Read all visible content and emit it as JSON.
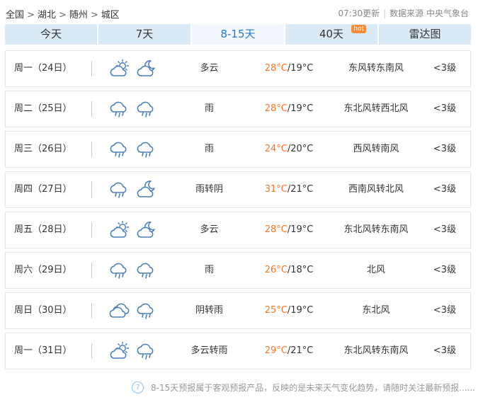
{
  "breadcrumb": {
    "items": [
      "全国",
      "湖北",
      "随州",
      "城区"
    ],
    "separator": ">"
  },
  "meta": {
    "update_time": "07:30更新",
    "source_label": "数据来源",
    "source": "中央气象台"
  },
  "tabs": [
    {
      "label": "今天",
      "active": false
    },
    {
      "label": "7天",
      "active": false
    },
    {
      "label": "8-15天",
      "active": true
    },
    {
      "label": "40天",
      "active": false,
      "badge": "hot"
    },
    {
      "label": "雷达图",
      "active": false
    }
  ],
  "colors": {
    "accent": "#2a78c9",
    "tab_bg": "#dbeaf7",
    "high_temp": "#f0782a",
    "badge": "#ff8a38",
    "icon_stroke": "#4a7fb8"
  },
  "forecast": [
    {
      "day": "周一（24日）",
      "icons": [
        "partly-cloudy-sun-icon",
        "partly-cloudy-moon-icon"
      ],
      "condition": "多云",
      "high": "28°C",
      "low": "/19°C",
      "wind": "东风转东南风",
      "level": "<3级"
    },
    {
      "day": "周二（25日）",
      "icons": [
        "rain-icon",
        "rain-icon"
      ],
      "condition": "雨",
      "high": "28°C",
      "low": "/19°C",
      "wind": "东北风转西北风",
      "level": "<3级"
    },
    {
      "day": "周三（26日）",
      "icons": [
        "rain-icon",
        "rain-icon"
      ],
      "condition": "雨",
      "high": "24°C",
      "low": "/20°C",
      "wind": "西风转南风",
      "level": "<3级"
    },
    {
      "day": "周四（27日）",
      "icons": [
        "rain-icon",
        "moon-cloud-icon"
      ],
      "condition": "雨转阴",
      "high": "31°C",
      "low": "/21°C",
      "wind": "西南风转北风",
      "level": "<3级"
    },
    {
      "day": "周五（28日）",
      "icons": [
        "partly-cloudy-sun-icon",
        "partly-cloudy-moon-icon"
      ],
      "condition": "多云",
      "high": "28°C",
      "low": "/19°C",
      "wind": "东北风转东南风",
      "level": "<3级"
    },
    {
      "day": "周六（29日）",
      "icons": [
        "rain-icon",
        "rain-icon"
      ],
      "condition": "雨",
      "high": "26°C",
      "low": "/18°C",
      "wind": "北风",
      "level": "<3级"
    },
    {
      "day": "周日（30日）",
      "icons": [
        "cloudy-icon",
        "rain-icon"
      ],
      "condition": "阴转雨",
      "high": "25°C",
      "low": "/19°C",
      "wind": "东北风",
      "level": "<3级"
    },
    {
      "day": "周一（31日）",
      "icons": [
        "partly-cloudy-sun-icon",
        "rain-icon"
      ],
      "condition": "多云转雨",
      "high": "29°C",
      "low": "/21°C",
      "wind": "东北风转东南风",
      "level": "<3级"
    }
  ],
  "footer": {
    "icon": "question-icon",
    "text": "8-15天预报属于客观预报产品，反映的是未来天气变化趋势，请随时关注最新预报......"
  }
}
